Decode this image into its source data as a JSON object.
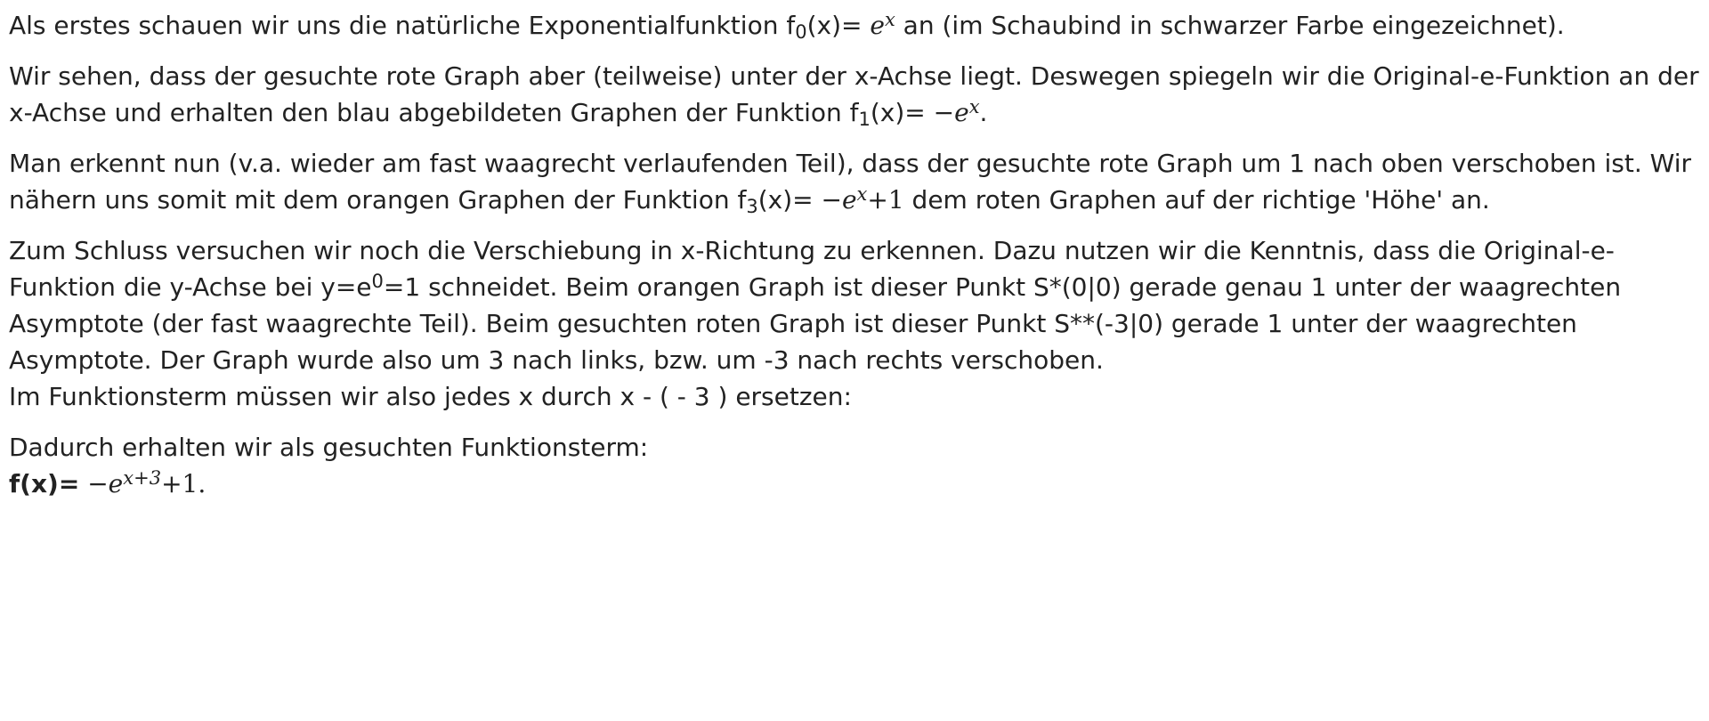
{
  "p1": {
    "before": "Als erstes schauen wir uns die natürliche Exponentialfunktion f",
    "sub": "0",
    "mid": "(x)= ",
    "e": "e",
    "exp": "x",
    "after": " an (im Schaubind in schwarzer Farbe eingezeichnet)."
  },
  "p2": {
    "before": "Wir sehen, dass der gesuchte rote Graph aber (teilweise) unter der x-Achse liegt. Deswegen spiegeln wir die Original-e-Funktion an der x-Achse und erhalten den blau abgebildeten Graphen der Funktion f",
    "sub": "1",
    "mid": "(x)= ",
    "minus": "−",
    "e": "e",
    "exp": "x",
    "after": "."
  },
  "p3": {
    "before": "Man erkennt nun (v.a. wieder am fast waagrecht verlaufenden Teil), dass der gesuchte rote Graph um 1 nach oben verschoben ist. Wir nähern uns somit mit dem orangen Graphen der Funktion f",
    "sub": "3",
    "mid": "(x)= ",
    "minus": "−",
    "e": "e",
    "exp": "x",
    "plus_one": "+1",
    "after": " dem roten Graphen auf der richtige 'Höhe' an."
  },
  "p4": {
    "before": "Zum Schluss versuchen wir noch die Verschiebung in x-Richtung zu erkennen. Dazu nutzen wir die Kenntnis, dass die Original-e-Funktion die y-Achse bei y=e",
    "sup": "0",
    "after": "=1 schneidet. Beim orangen Graph ist dieser Punkt S*(0|0) gerade genau 1 unter der waagrechten Asymptote (der fast waagrechte Teil). Beim gesuchten roten Graph ist dieser Punkt S**(-3|0) gerade 1 unter der waagrechten Asymptote. Der Graph wurde also um 3 nach links, bzw. um -3 nach rechts verschoben.",
    "line2": "Im Funktionsterm müssen wir also jedes x durch x - ( - 3 ) ersetzen:"
  },
  "p5": {
    "line1": "Dadurch erhalten wir als gesuchten Funktionsterm:",
    "label": "f(x)=",
    "minus": "−",
    "e": "e",
    "exp": "x+3",
    "plus_one": "+1",
    "after": "."
  }
}
